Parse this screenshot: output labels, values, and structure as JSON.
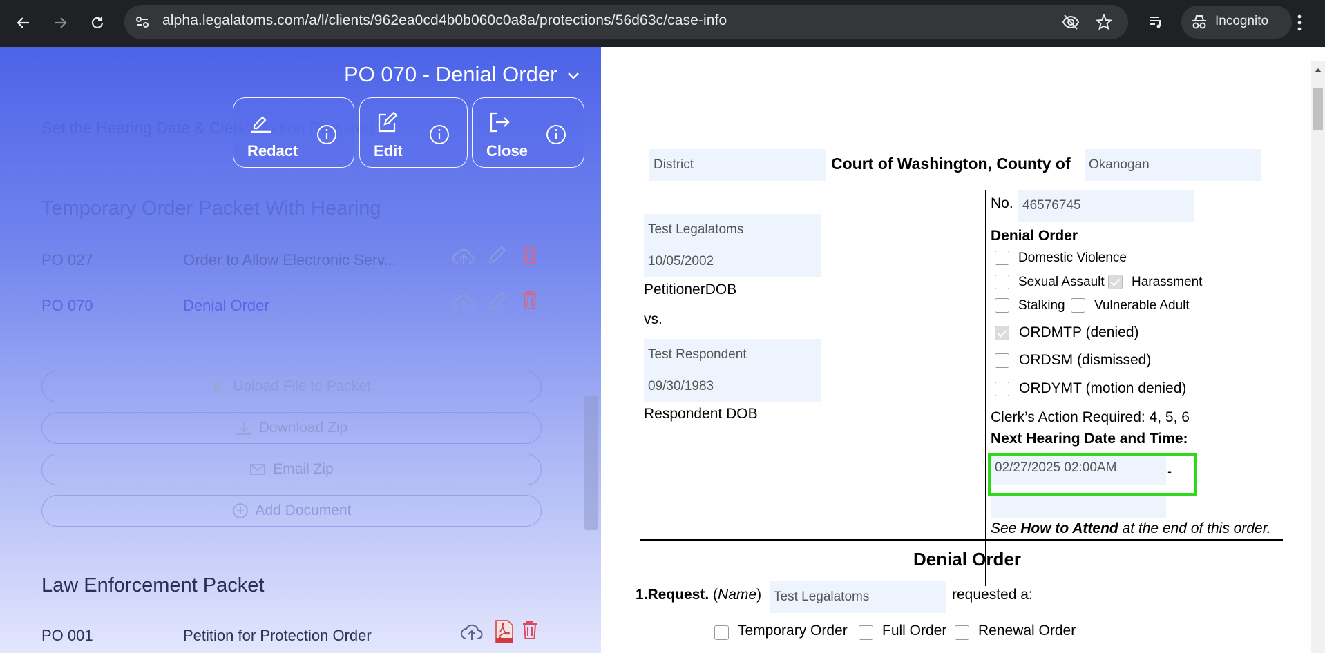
{
  "browser": {
    "url": "alpha.legalatoms.com/a/l/clients/962ea0cd4b0b060c0a8a/protections/56d63c/case-info",
    "incognito_label": "Incognito"
  },
  "panel": {
    "doc_title": "PO 070 - Denial Order",
    "ghost_text": "Set the Hearing Date & Clerk's Action Required",
    "actions": [
      {
        "label": "Redact"
      },
      {
        "label": "Edit"
      },
      {
        "label": "Close"
      }
    ],
    "packet1": {
      "title": "Temporary Order Packet With Hearing",
      "rows": [
        {
          "code": "PO 027",
          "name": "Order to Allow Electronic Serv..."
        },
        {
          "code": "PO 070",
          "name": "Denial Order"
        }
      ]
    },
    "buttons": {
      "upload": "Upload File to Packet",
      "download": "Download Zip",
      "email": "Email Zip",
      "add": "Add Document"
    },
    "packet2": {
      "title": "Law Enforcement Packet",
      "rows": [
        {
          "code": "PO 001",
          "name": "Petition for Protection Order"
        }
      ]
    }
  },
  "document": {
    "court_type": "District",
    "court_of": "Court of Washington, County of",
    "county": "Okanogan",
    "no_label": "No.",
    "case_no": "46576745",
    "petitioner_name": "Test  Legalatoms",
    "petitioner_dob": "10/05/2002",
    "petitioner_label": "PetitionerDOB",
    "vs": "vs.",
    "respondent_name": "Test  Respondent",
    "respondent_dob": "09/30/1983",
    "respondent_label": "Respondent DOB",
    "order_heading": "Denial Order",
    "types": {
      "dv": "Domestic Violence",
      "sa": "Sexual Assault",
      "har": "Harassment",
      "stalk": "Stalking",
      "va": "Vulnerable Adult"
    },
    "ordmtp": "ORDMTP (denied)",
    "ordsm": "ORDSM (dismissed)",
    "ordymt": "ORDYMT (motion denied)",
    "clerk_action": "Clerk’s Action Required: 4, 5, 6",
    "next_hearing_label": "Next Hearing Date and Time:",
    "next_hearing_value": "02/27/2025 02:00AM",
    "dash": "-",
    "see_prefix": "See ",
    "see_bold": "How to Attend",
    "see_suffix": " at the end of this order.",
    "title": "Denial Order",
    "request_num": "1.Request.",
    "request_name_label": "Name",
    "request_name": "Test  Legalatoms",
    "requested_a": "requested a:",
    "order_types": {
      "temporary": "Temporary Order",
      "full": "Full Order",
      "renewal": "Renewal Order"
    }
  }
}
